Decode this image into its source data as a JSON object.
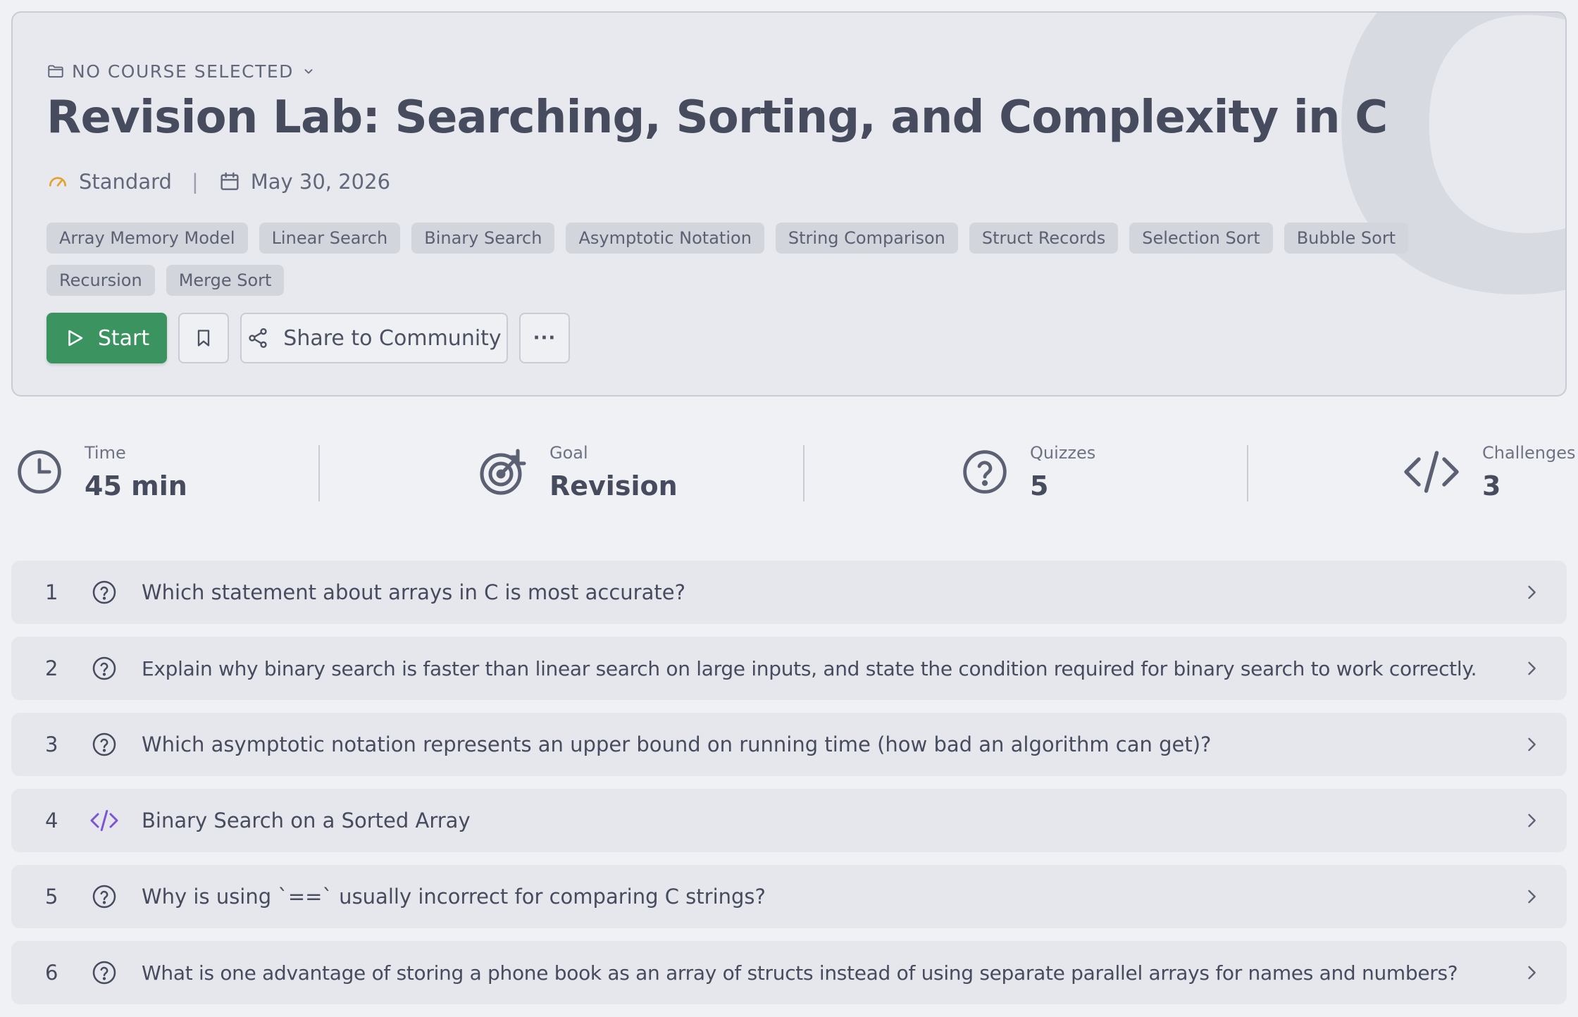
{
  "header": {
    "course_selector": "NO COURSE SELECTED",
    "title": "Revision Lab: Searching, Sorting, and Complexity in C",
    "difficulty": "Standard",
    "separator": "|",
    "date": "May 30, 2026",
    "watermark": "C",
    "tags": [
      "Array Memory Model",
      "Linear Search",
      "Binary Search",
      "Asymptotic Notation",
      "String Comparison",
      "Struct Records",
      "Selection Sort",
      "Bubble Sort",
      "Recursion",
      "Merge Sort"
    ],
    "actions": {
      "start_label": "Start",
      "share_label": "Share to Community",
      "more_label": "···"
    }
  },
  "stats": {
    "time": {
      "label": "Time",
      "value": "45 min"
    },
    "goal": {
      "label": "Goal",
      "value": "Revision"
    },
    "quizzes": {
      "label": "Quizzes",
      "value": "5"
    },
    "challenges": {
      "label": "Challenges",
      "value": "3"
    }
  },
  "items": [
    {
      "num": "1",
      "icon": "question-circle-icon",
      "text": "Which statement about arrays in C is most accurate?"
    },
    {
      "num": "2",
      "icon": "question-circle-icon",
      "text": "Explain why binary search is faster than linear search on large inputs, and state the condition required for binary search to work correctly."
    },
    {
      "num": "3",
      "icon": "question-circle-icon",
      "text": "Which asymptotic notation represents an upper bound on running time (how bad an algorithm can get)?"
    },
    {
      "num": "4",
      "icon": "code-icon",
      "text": "Binary Search on a Sorted Array"
    },
    {
      "num": "5",
      "icon": "question-circle-icon",
      "text": "Why is using `==` usually incorrect for comparing C strings?"
    },
    {
      "num": "6",
      "icon": "question-circle-icon",
      "text": "What is one advantage of storing a phone book as an array of structs instead of using separate parallel arrays for names and numbers?"
    }
  ],
  "colors": {
    "primary_green": "#3b9460",
    "accent_amber": "#e3a32a",
    "code_purple": "#7b55d6",
    "text_dark": "#474b5e"
  }
}
